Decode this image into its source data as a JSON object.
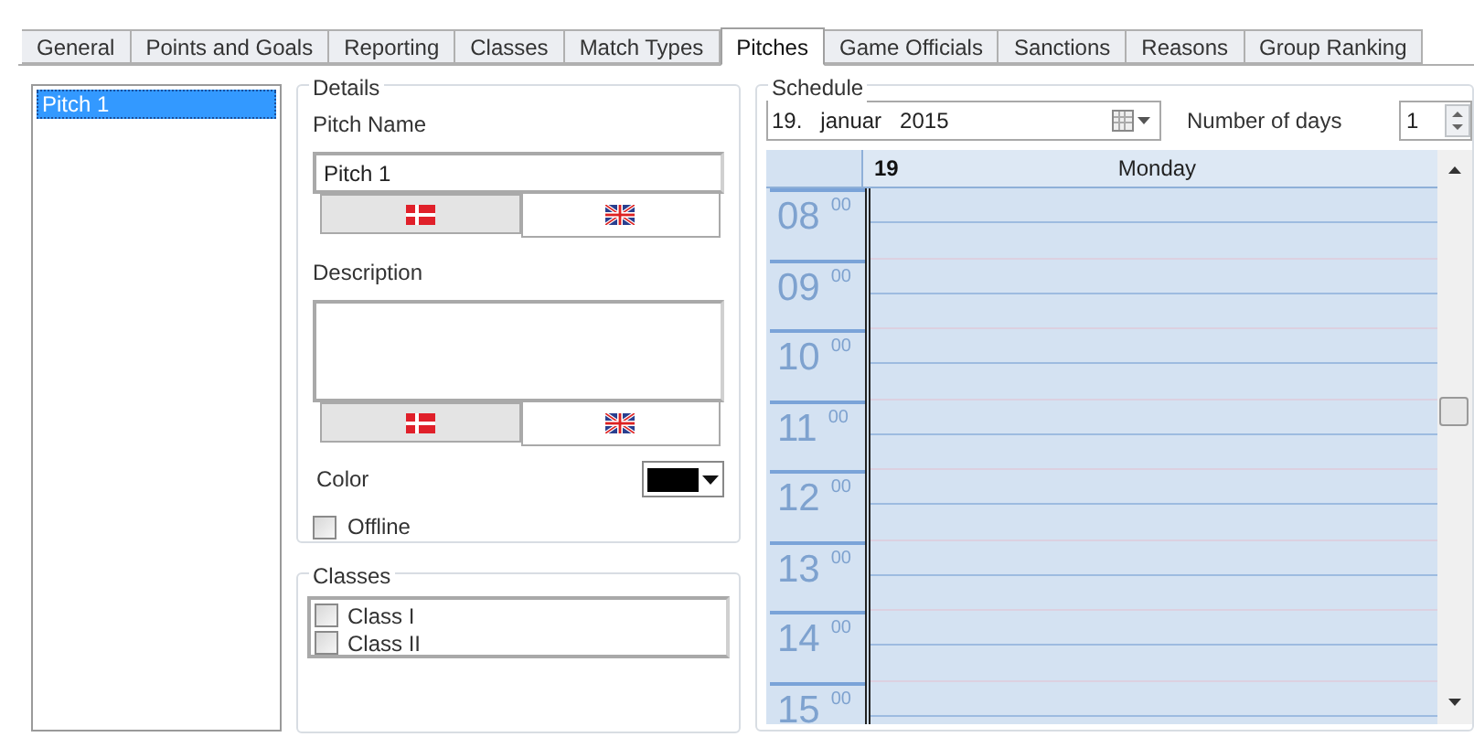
{
  "tabs": [
    {
      "label": "General",
      "selected": false
    },
    {
      "label": "Points and Goals",
      "selected": false
    },
    {
      "label": "Reporting",
      "selected": false
    },
    {
      "label": "Classes",
      "selected": false
    },
    {
      "label": "Match Types",
      "selected": false
    },
    {
      "label": "Pitches",
      "selected": true
    },
    {
      "label": "Game Officials",
      "selected": false
    },
    {
      "label": "Sanctions",
      "selected": false
    },
    {
      "label": "Reasons",
      "selected": false
    },
    {
      "label": "Group Ranking",
      "selected": false
    }
  ],
  "pitch_list": [
    {
      "label": "Pitch 1",
      "selected": true
    }
  ],
  "details": {
    "title": "Details",
    "pitch_name_label": "Pitch Name",
    "pitch_name_value": "Pitch 1",
    "name_languages": [
      {
        "kind": "dk",
        "selected": true
      },
      {
        "kind": "gb",
        "selected": false
      }
    ],
    "description_label": "Description",
    "description_languages": [
      {
        "kind": "dk",
        "selected": true
      },
      {
        "kind": "gb",
        "selected": false
      }
    ],
    "color_label": "Color",
    "color": "#000000",
    "offline": {
      "label": "Offline",
      "checked": false
    }
  },
  "classes": {
    "title": "Classes",
    "items": [
      {
        "label": "Class I",
        "checked": false
      },
      {
        "label": "Class II",
        "checked": false
      }
    ]
  },
  "schedule": {
    "title": "Schedule",
    "date": "19.   januar   2015",
    "days_label": "Number of days",
    "days_value": "1",
    "day_number": "19",
    "day_name": "Monday",
    "hours": [
      {
        "hour": "08",
        "minutes": "00"
      },
      {
        "hour": "09",
        "minutes": "00"
      },
      {
        "hour": "10",
        "minutes": "00"
      },
      {
        "hour": "11",
        "minutes": "00"
      },
      {
        "hour": "12",
        "minutes": "00"
      },
      {
        "hour": "13",
        "minutes": "00"
      },
      {
        "hour": "14",
        "minutes": "00"
      },
      {
        "hour": "15",
        "minutes": "00"
      }
    ]
  }
}
